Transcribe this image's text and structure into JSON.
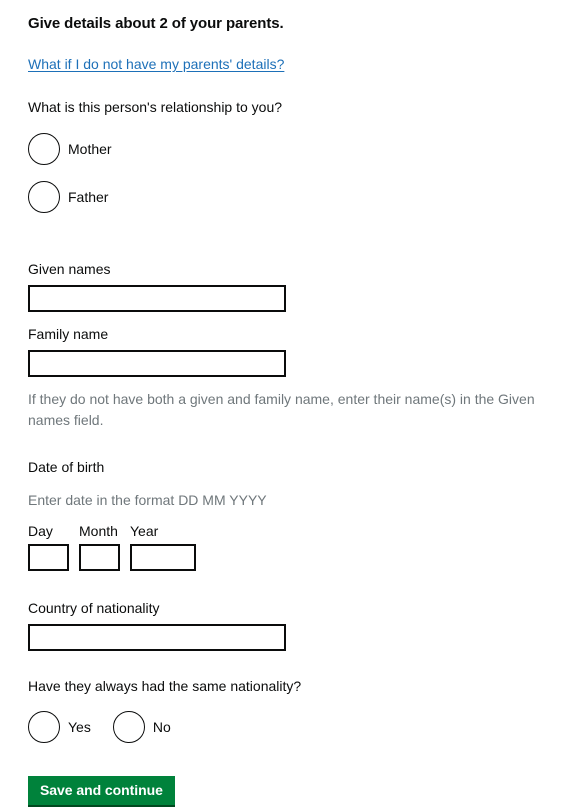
{
  "form": {
    "heading": "Give details about 2 of your parents.",
    "help_link": "What if I do not have my parents' details?",
    "relationship": {
      "question": "What is this person's relationship to you?",
      "options": [
        {
          "label": "Mother",
          "selected": false
        },
        {
          "label": "Father",
          "selected": false
        }
      ]
    },
    "given_names": {
      "label": "Given names",
      "value": "",
      "placeholder": ""
    },
    "family_name": {
      "label": "Family name",
      "value": "",
      "placeholder": ""
    },
    "name_hint": "If they do not have both a given and family name, enter their name(s) in the Given names field.",
    "date_of_birth": {
      "label": "Date of birth",
      "hint": "Enter date in the format DD MM YYYY",
      "day": {
        "label": "Day",
        "value": "",
        "placeholder": ""
      },
      "month": {
        "label": "Month",
        "value": "",
        "placeholder": ""
      },
      "year": {
        "label": "Year",
        "value": "",
        "placeholder": ""
      }
    },
    "country_of_nationality": {
      "label": "Country of nationality",
      "value": "",
      "placeholder": ""
    },
    "same_nationality": {
      "question": "Have they always had the same nationality?",
      "options": [
        {
          "label": "Yes",
          "selected": false
        },
        {
          "label": "No",
          "selected": false
        }
      ]
    },
    "submit_label": "Save and continue"
  },
  "colors": {
    "text": "#0b0c0c",
    "hint": "#6f777b",
    "link": "#1d70b8",
    "button_green": "#00823b",
    "button_green_shadow": "#00491f",
    "border": "#0b0c0c",
    "background": "#ffffff"
  }
}
